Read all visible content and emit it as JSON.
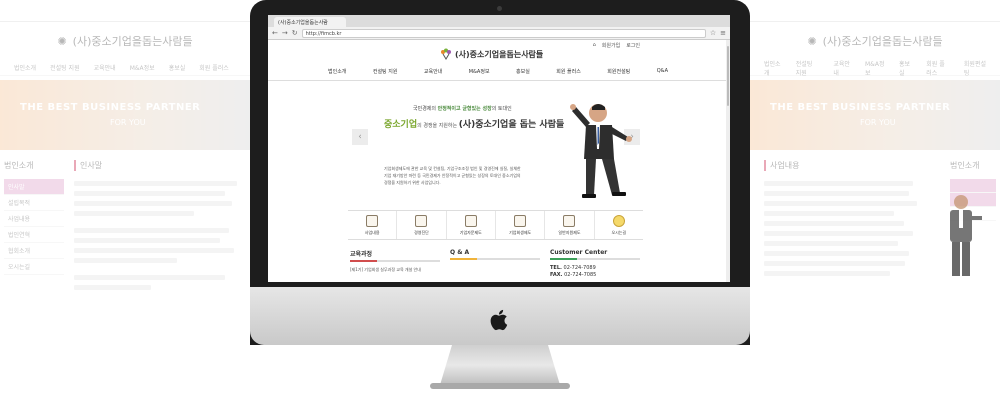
{
  "background_left": {
    "logo": "(사)중소기업을돕는사람들",
    "nav": [
      "법인소개",
      "전설팅 지원",
      "교육안내",
      "M&A정보",
      "홍보실",
      "회원 플러스"
    ],
    "banner_title": "THE BEST BUSINESS PARTNER",
    "banner_sub": "FOR YOU",
    "side_title": "법인소개",
    "side_items": [
      "인사말",
      "설립목적",
      "사업내용",
      "법인연혁",
      "협회소개",
      "오시는길"
    ],
    "main_title": "인사말"
  },
  "background_right": {
    "logo": "(사)중소기업을돕는사람들",
    "nav": [
      "법인소개",
      "전설팅 지원",
      "교육안내",
      "M&A정보",
      "홍보실",
      "회원 플러스",
      "회원편설팅"
    ],
    "banner_title": "THE BEST BUSINESS PARTNER",
    "banner_sub": "FOR YOU",
    "side_title": "법인소개",
    "main_title": "사업내용"
  },
  "browser": {
    "tab_title": "(사)중소기업을돕는사람",
    "url": "http://fimcb.kr",
    "utility_links": [
      "회원가입",
      "로그인"
    ]
  },
  "site": {
    "logo_text": "(사)중소기업을돕는사람들",
    "nav": [
      "법인소개",
      "컨설팅 지원",
      "교육안내",
      "M&A정보",
      "홍보실",
      "회원 플러스",
      "회원전설팅",
      "Q&A"
    ],
    "hero": {
      "line1_pre": "국민경제의 ",
      "line1_em": "안정적이고 균형있는 성장",
      "line1_post": "의 토대인",
      "line2_green": "중소기업",
      "line2_small": "의 경쟁을 지원하는 ",
      "line2_bold": "(사)중소기업을 돕는 사람들",
      "desc": "기업회생제도에 관한 교육 및 컨설팅, 기업구조조정 법인 및 경영진에 실질, 실체한 기업 재기방안 마련 등 국민경제가 안정적이고 균형있는 성장의 토대인 중소기업의 경쟁을 지원하기 위한 사업입니다."
    },
    "quick_icons": [
      "사업내용",
      "경영진단",
      "기업자문제도",
      "기업회생제도",
      "일반지원제도",
      "오시는길"
    ],
    "boxes": {
      "edu_title": "교육과정",
      "edu_item": "[제1기] 기업회생 실무과정 교육 개설 안내",
      "qna_title": "Q & A",
      "cs_title": "Customer Center",
      "tel_label": "TEL.",
      "tel": "02-724-7089",
      "fax_label": "FAX.",
      "fax": "02-724-7085"
    }
  }
}
